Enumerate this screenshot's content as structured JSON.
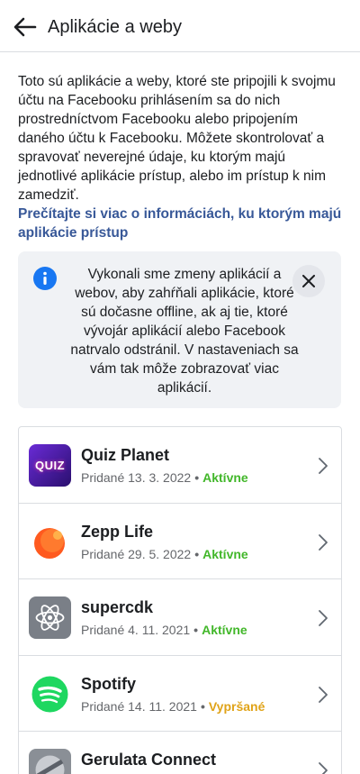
{
  "header": {
    "title": "Aplikácie a weby",
    "back_icon": "arrow-left-icon"
  },
  "intro": {
    "text": "Toto sú aplikácie a weby, ktoré ste pripojili k svojmu účtu na Facebooku prihlásením sa do nich prostredníctvom Facebooku alebo pripojením daného účtu k Facebooku. Môžete skontrolovať a spravovať neverejné údaje, ku ktorým majú jednotlivé aplikácie prístup, alebo im prístup k nim zamedziť.",
    "link": "Prečítajte si viac o informáciách, ku ktorým majú aplikácie prístup"
  },
  "notice": {
    "icon": "info-icon",
    "text": "Vykonali sme zmeny aplikácií a webov, aby zahŕňali aplikácie, ktoré sú dočasne offline, ak aj tie, ktoré vývojár aplikácií alebo Facebook natrvalo odstránil. V nastaveniach sa vám tak môže zobrazovať viac aplikácií.",
    "close_icon": "close-icon"
  },
  "apps": [
    {
      "name": "Quiz Planet",
      "added": "Pridané 13. 3. 2022",
      "separator": "•",
      "status": "Aktívne",
      "status_type": "active",
      "icon": "quiz-planet-icon",
      "icon_text": "QUIZ"
    },
    {
      "name": "Zepp Life",
      "added": "Pridané 29. 5. 2022",
      "separator": "•",
      "status": "Aktívne",
      "status_type": "active",
      "icon": "zepp-life-icon"
    },
    {
      "name": "supercdk",
      "added": "Pridané 4. 11. 2021",
      "separator": "•",
      "status": "Aktívne",
      "status_type": "active",
      "icon": "atom-icon"
    },
    {
      "name": "Spotify",
      "added": "Pridané 14. 11. 2021",
      "separator": "•",
      "status": "Vypršané",
      "status_type": "expired",
      "icon": "spotify-icon"
    },
    {
      "name": "Gerulata Connect",
      "added": "",
      "separator": "",
      "status": "",
      "status_type": "",
      "icon": "gerulata-icon"
    }
  ],
  "colors": {
    "link": "#385898",
    "active": "#42b72a",
    "expired": "#e0a318",
    "info": "#1877f2",
    "spotify": "#1ed760",
    "zepp": "#ff5722"
  }
}
